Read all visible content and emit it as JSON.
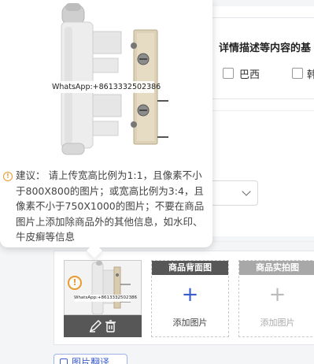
{
  "notice": {
    "title": "详情描述等内容的基",
    "options": [
      "巴西",
      "韩"
    ]
  },
  "image_slots": [
    {
      "header": "商品背面图",
      "action": "添加图片",
      "header_color": "#575757",
      "plus_color": "#3a5ccc",
      "text_color": "#444",
      "enabled": true
    },
    {
      "header": "商品实拍图",
      "action": "添加图片",
      "header_color": "#a8a8a8",
      "plus_color": "#bbbbbb",
      "text_color": "#aaaaaa",
      "enabled": false
    }
  ],
  "bottom_button": {
    "label": "图片翻译"
  },
  "tooltip": {
    "watermark": "WhatsApp:+8613332502386",
    "icon": "warning-circle-icon",
    "text": "建议： 请上传宽高比例为1:1，且像素不小于800X800的图片；或宽高比例为3:4，且像素不小于750X1000的图片；不要在商品图片上添加除商品外的其他信息，如水印、牛皮癣等信息"
  },
  "thumb": {
    "watermark": "WhatsApp:+8613332502386",
    "actions": [
      "edit-icon",
      "delete-icon"
    ]
  },
  "colors": {
    "accent": "#3a5ccc",
    "warning": "#e89a2e",
    "dark_bar": "#575757"
  }
}
